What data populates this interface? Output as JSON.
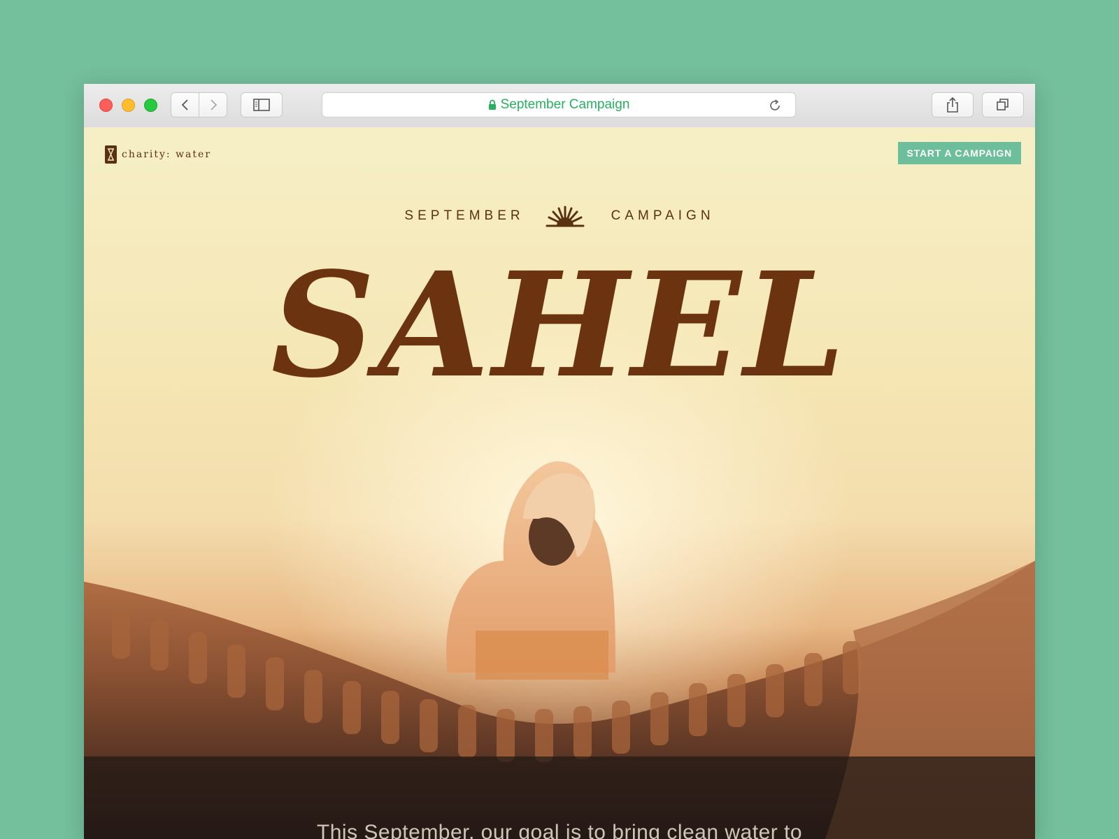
{
  "browser": {
    "url_title": "September Campaign",
    "icons": {
      "back": "chevron-left-icon",
      "forward": "chevron-right-icon",
      "sidebar": "sidebar-icon",
      "lock": "lock-icon",
      "reload": "reload-icon",
      "share": "share-icon",
      "tabs": "tabs-icon"
    },
    "url_color": "#27b060"
  },
  "site": {
    "logo_text": "charity: water",
    "cta_label": "START A CAMPAIGN",
    "cta_color": "#6dbf9b"
  },
  "hero": {
    "eyebrow_left": "SEPTEMBER",
    "eyebrow_right": "CAMPAIGN",
    "title": "SAHEL",
    "intro": "This September, our goal is to bring clean water to",
    "title_color": "#6b3310"
  },
  "background_color": "#74bf9c"
}
